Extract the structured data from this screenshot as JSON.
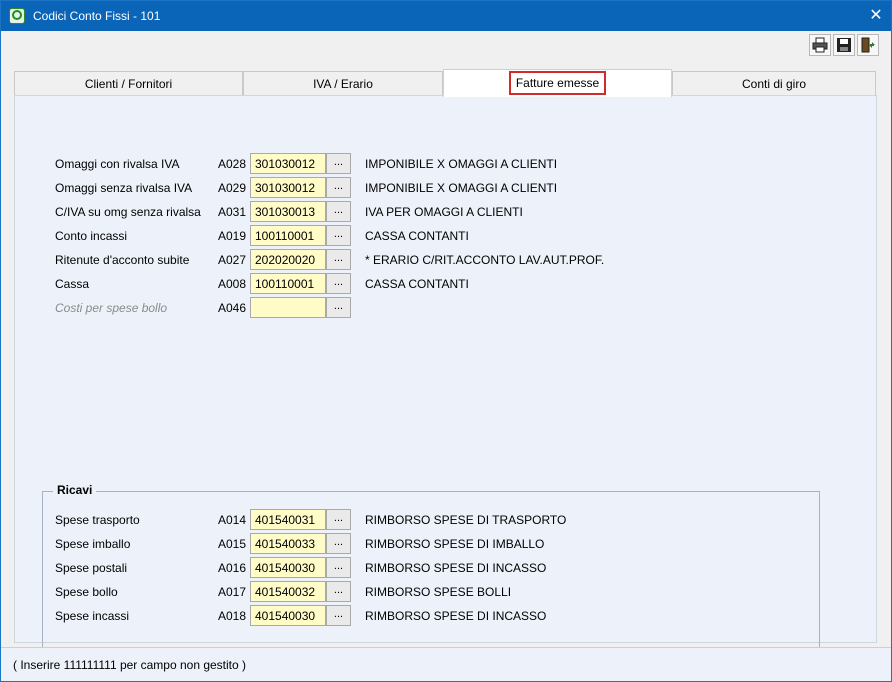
{
  "window": {
    "title": "Codici Conto Fissi - 101",
    "close": "✕"
  },
  "toolbar": {
    "print_icon": "printer-icon",
    "save_icon": "floppy-disk-icon",
    "exit_icon": "exit-door-icon"
  },
  "tabs": [
    {
      "label": "Clienti / Fornitori"
    },
    {
      "label": "IVA / Erario"
    },
    {
      "label": "Fatture emesse"
    },
    {
      "label": "Conti di giro"
    }
  ],
  "fields": [
    {
      "label": "Omaggi con   rivalsa IVA",
      "code": "A028",
      "value": "301030012",
      "desc": "IMPONIBILE X OMAGGI A CLIENTI"
    },
    {
      "label": "Omaggi senza rivalsa IVA",
      "code": "A029",
      "value": "301030012",
      "desc": "IMPONIBILE X OMAGGI A CLIENTI"
    },
    {
      "label": "C/IVA su omg senza rivalsa",
      "code": "A031",
      "value": "301030013",
      "desc": "IVA PER OMAGGI A CLIENTI"
    },
    {
      "label": "Conto incassi",
      "code": "A019",
      "value": "100110001",
      "desc": "CASSA CONTANTI"
    },
    {
      "label": "Ritenute d'acconto subite",
      "code": "A027",
      "value": "202020020",
      "desc": "* ERARIO C/RIT.ACCONTO LAV.AUT.PROF."
    },
    {
      "label": "Cassa",
      "code": "A008",
      "value": "100110001",
      "desc": "CASSA CONTANTI"
    },
    {
      "label": "Costi per spese bollo",
      "code": "A046",
      "value": "",
      "desc": ""
    }
  ],
  "ricavi": {
    "title": "Ricavi",
    "fields": [
      {
        "label": "Spese trasporto",
        "code": "A014",
        "value": "401540031",
        "desc": "RIMBORSO SPESE DI TRASPORTO"
      },
      {
        "label": "Spese imballo",
        "code": "A015",
        "value": "401540033",
        "desc": "RIMBORSO SPESE DI IMBALLO"
      },
      {
        "label": "Spese postali",
        "code": "A016",
        "value": "401540030",
        "desc": "RIMBORSO SPESE DI INCASSO"
      },
      {
        "label": "Spese bollo",
        "code": "A017",
        "value": "401540032",
        "desc": "RIMBORSO SPESE BOLLI"
      },
      {
        "label": "Spese incassi",
        "code": "A018",
        "value": "401540030",
        "desc": "RIMBORSO SPESE DI INCASSO"
      }
    ]
  },
  "browse_label": "...",
  "status": "( Inserire 111111111 per campo non gestito )"
}
